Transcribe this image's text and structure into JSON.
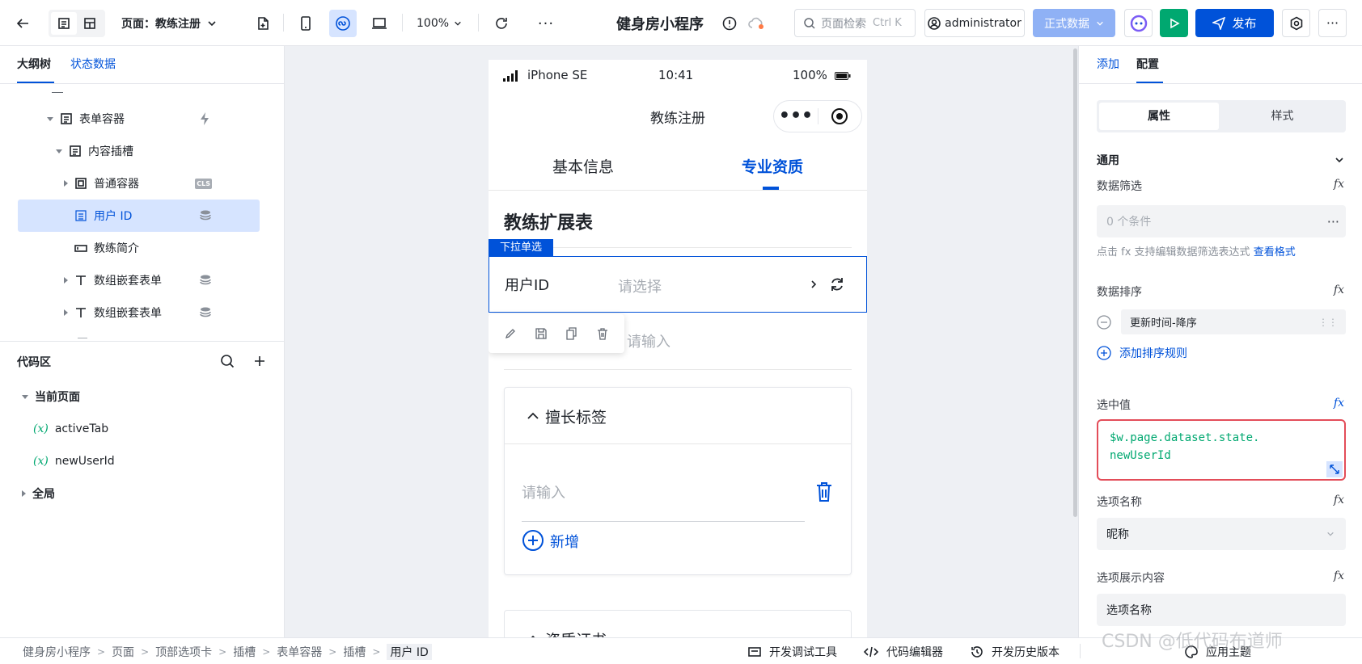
{
  "topbar": {
    "page_label": "页面：教练注册",
    "zoom": "100%",
    "app_title": "健身房小程序",
    "search_placeholder": "页面检索",
    "search_shortcut": "Ctrl K",
    "user": "administrator",
    "env_label": "正式数据",
    "publish_label": "发布"
  },
  "left": {
    "tabs": [
      "大纲树",
      "状态数据"
    ],
    "tree": [
      {
        "label": "表单容器"
      },
      {
        "label": "内容插槽"
      },
      {
        "label": "普通容器",
        "badge": "CLS"
      },
      {
        "label": "用户 ID"
      },
      {
        "label": "教练简介"
      },
      {
        "label": "数组嵌套表单"
      },
      {
        "label": "数组嵌套表单"
      }
    ],
    "code_title": "代码区",
    "current_page": "当前页面",
    "vars": [
      "activeTab",
      "newUserId"
    ],
    "var_prefix": "(x)",
    "global": "全局"
  },
  "phone": {
    "status": {
      "carrier": "iPhone SE",
      "time": "10:41",
      "battery": "100%"
    },
    "nav_title": "教练注册",
    "tabs": [
      "基本信息",
      "专业资质"
    ],
    "form_title": "教练扩展表",
    "select_tag": "下拉单选",
    "field_label": "用户ID",
    "field_placeholder": "请选择",
    "hidden_input": "请输入",
    "section_title": "擅长标签",
    "tag_placeholder": "请输入",
    "add_label": "新增",
    "next_section": "资质证书"
  },
  "right": {
    "tabs": [
      "添加",
      "配置"
    ],
    "seg": [
      "属性",
      "样式"
    ],
    "group": "通用",
    "filter_label": "数据筛选",
    "filter_value": "0 个条件",
    "filter_hint": "点击 fx 支持编辑数据筛选表达式",
    "filter_link": "查看格式",
    "sort_label": "数据排序",
    "sort_value": "更新时间-降序",
    "add_sort": "添加排序规则",
    "selected_label": "选中值",
    "selected_value_line1": "$w.page.dataset.state.",
    "selected_value_line2": "newUserId",
    "option_name_label": "选项名称",
    "option_name_value": "昵称",
    "option_display_label": "选项展示内容",
    "option_display_value": "选项名称",
    "fx": "fx"
  },
  "bottom": {
    "crumbs": [
      "健身房小程序",
      "页面",
      "顶部选项卡",
      "插槽",
      "表单容器",
      "插槽",
      "用户 ID"
    ],
    "tools": [
      "开发调试工具",
      "代码编辑器",
      "开发历史版本",
      "应用主题"
    ]
  },
  "watermark": "CSDN @低代码布道师",
  "colors": {
    "accent": "#0052d9",
    "selected_bg": "#d6e4ff",
    "danger": "#e34d59",
    "green": "#00a870",
    "env": "#8fb1f5"
  }
}
